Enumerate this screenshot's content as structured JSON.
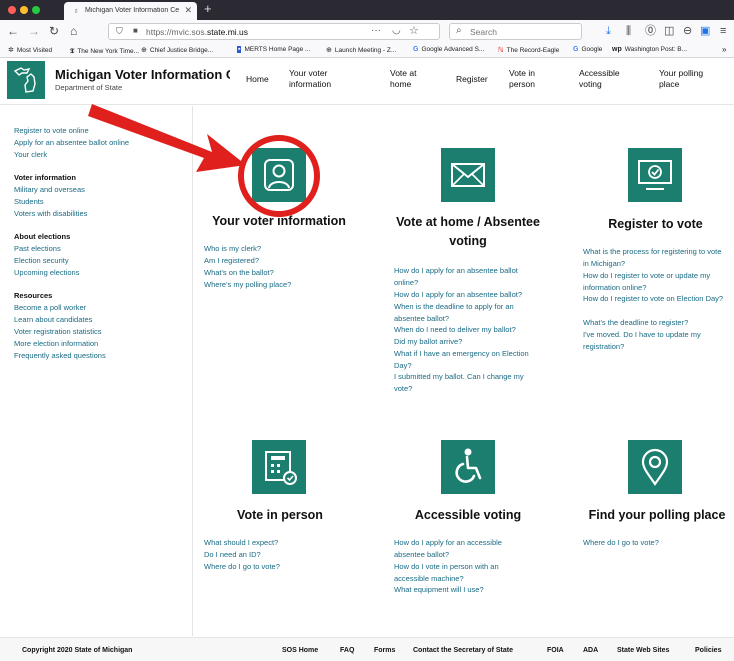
{
  "browser": {
    "tab_title": "Michigan Voter Information Ce",
    "url_host": "https://mvic.sos.",
    "url_domain": "state.mi.us",
    "search_placeholder": "Search",
    "bookmarks": [
      "Most Visited",
      "The New York Time...",
      "Chief Justice Bridge...",
      "MERTS Home Page ...",
      "Launch Meeting - Z...",
      "Google Advanced S...",
      "The Record-Eagle",
      "Google",
      "Washington Post: B..."
    ]
  },
  "site": {
    "title": "Michigan Voter Information Cent",
    "subtitle": "Department of State",
    "nav": [
      "Home",
      "Your voter information",
      "Vote at home",
      "Register",
      "Vote in person",
      "Accessible voting",
      "Your polling place"
    ]
  },
  "sidebar": {
    "top_links": [
      "Register to vote online",
      "Apply for an absentee ballot online",
      "Your clerk"
    ],
    "voter_info_head": "Voter information",
    "voter_info_links": [
      "Military and overseas",
      "Students",
      "Voters with disabilities"
    ],
    "elections_head": "About elections",
    "elections_links": [
      "Past elections",
      "Election security",
      "Upcoming elections"
    ],
    "resources_head": "Resources",
    "resources_links": [
      "Become a poll worker",
      "Learn about candidates",
      "Voter registration statistics",
      "More election information",
      "Frequently asked questions"
    ]
  },
  "cards": {
    "voter_info": {
      "title": "Your voter information",
      "questions": [
        "Who is my clerk?",
        "Am I registered?",
        "What's on the ballot?",
        "Where's my polling place?"
      ]
    },
    "vote_home": {
      "title": "Vote at home / Absentee voting",
      "questions": [
        "How do I apply for an absentee ballot online?",
        "How do I apply for an absentee ballot?",
        "When is the deadline to apply for an absentee ballot?",
        "When do I need to deliver my ballot?",
        "Did my ballot arrive?",
        "What if I have an emergency on Election Day?",
        "I submitted my ballot. Can I change my vote?"
      ]
    },
    "register": {
      "title": "Register to vote",
      "questions": [
        "What is the process for registering to vote in Michigan?",
        "How do I register to vote or update my information online?",
        "How do I register to vote on Election Day?",
        "What's the deadline to register?",
        "I've moved. Do I have to update my registration?"
      ]
    },
    "vote_person": {
      "title": "Vote in person",
      "questions": [
        "What should I expect?",
        "Do I need an ID?",
        "Where do I go to vote?"
      ]
    },
    "accessible": {
      "title": "Accessible voting",
      "questions": [
        "How do I apply for an accessible absentee ballot?",
        "How do I vote in person with an accessible machine?",
        "What equipment will I use?"
      ]
    },
    "polling": {
      "title": "Find your polling place",
      "questions": [
        "Where do I go to vote?"
      ]
    }
  },
  "footer": {
    "copyright": "Copyright 2020 State of Michigan",
    "links": [
      "SOS Home",
      "FAQ",
      "Forms",
      "Contact the Secretary of State",
      "FOIA",
      "ADA",
      "State Web Sites",
      "Policies"
    ]
  },
  "colors": {
    "brand_teal": "#1c7e6e",
    "link": "#1a6b85",
    "annotation_red": "#e0201c"
  }
}
